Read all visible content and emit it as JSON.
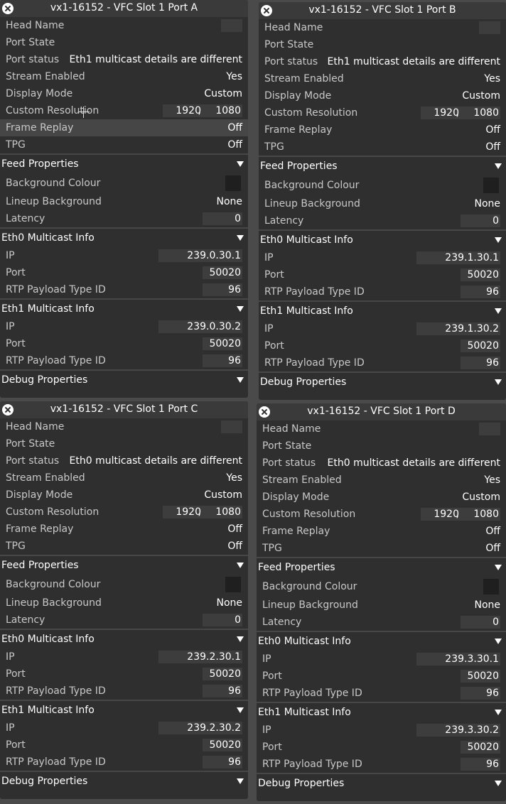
{
  "labels": {
    "head_name": "Head Name",
    "port_state": "Port State",
    "port_status": "Port status",
    "stream_enabled": "Stream Enabled",
    "display_mode": "Display Mode",
    "custom_resolution": "Custom Resolution",
    "frame_replay": "Frame Replay",
    "tpg": "TPG",
    "feed_properties": "Feed Properties",
    "background_colour": "Background Colour",
    "lineup_background": "Lineup Background",
    "latency": "Latency",
    "eth0_multicast_info": "Eth0 Multicast Info",
    "eth1_multicast_info": "Eth1 Multicast Info",
    "ip": "IP",
    "port": "Port",
    "rtp_payload_type_id": "RTP Payload Type ID",
    "debug_properties": "Debug Properties"
  },
  "panels": [
    {
      "title": "vx1-16152 - VFC Slot 1 Port A",
      "port_status": "Eth1 multicast details are different",
      "stream_enabled": "Yes",
      "display_mode": "Custom",
      "res_width": "1920",
      "res_height": "1080",
      "frame_replay": "Off",
      "tpg": "Off",
      "background_colour": "#1f1f1f",
      "lineup_background": "None",
      "latency": "0",
      "eth0": {
        "ip": "239.0.30.1",
        "port": "50020",
        "rtp": "96"
      },
      "eth1": {
        "ip": "239.0.30.2",
        "port": "50020",
        "rtp": "96"
      }
    },
    {
      "title": "vx1-16152 - VFC Slot 1 Port B",
      "port_status": "Eth1 multicast details are different",
      "stream_enabled": "Yes",
      "display_mode": "Custom",
      "res_width": "1920",
      "res_height": "1080",
      "frame_replay": "Off",
      "tpg": "Off",
      "background_colour": "#1f1f1f",
      "lineup_background": "None",
      "latency": "0",
      "eth0": {
        "ip": "239.1.30.1",
        "port": "50020",
        "rtp": "96"
      },
      "eth1": {
        "ip": "239.1.30.2",
        "port": "50020",
        "rtp": "96"
      }
    },
    {
      "title": "vx1-16152 - VFC Slot 1 Port C",
      "port_status": "Eth0 multicast details are different",
      "stream_enabled": "Yes",
      "display_mode": "Custom",
      "res_width": "1920",
      "res_height": "1080",
      "frame_replay": "Off",
      "tpg": "Off",
      "background_colour": "#1f1f1f",
      "lineup_background": "None",
      "latency": "0",
      "eth0": {
        "ip": "239.2.30.1",
        "port": "50020",
        "rtp": "96"
      },
      "eth1": {
        "ip": "239.2.30.2",
        "port": "50020",
        "rtp": "96"
      }
    },
    {
      "title": "vx1-16152 - VFC Slot 1 Port D",
      "port_status": "Eth0 multicast details are different",
      "stream_enabled": "Yes",
      "display_mode": "Custom",
      "res_width": "1920",
      "res_height": "1080",
      "frame_replay": "Off",
      "tpg": "Off",
      "background_colour": "#1f1f1f",
      "lineup_background": "None",
      "latency": "0",
      "eth0": {
        "ip": "239.3.30.1",
        "port": "50020",
        "rtp": "96"
      },
      "eth1": {
        "ip": "239.3.30.2",
        "port": "50020",
        "rtp": "96"
      }
    }
  ]
}
